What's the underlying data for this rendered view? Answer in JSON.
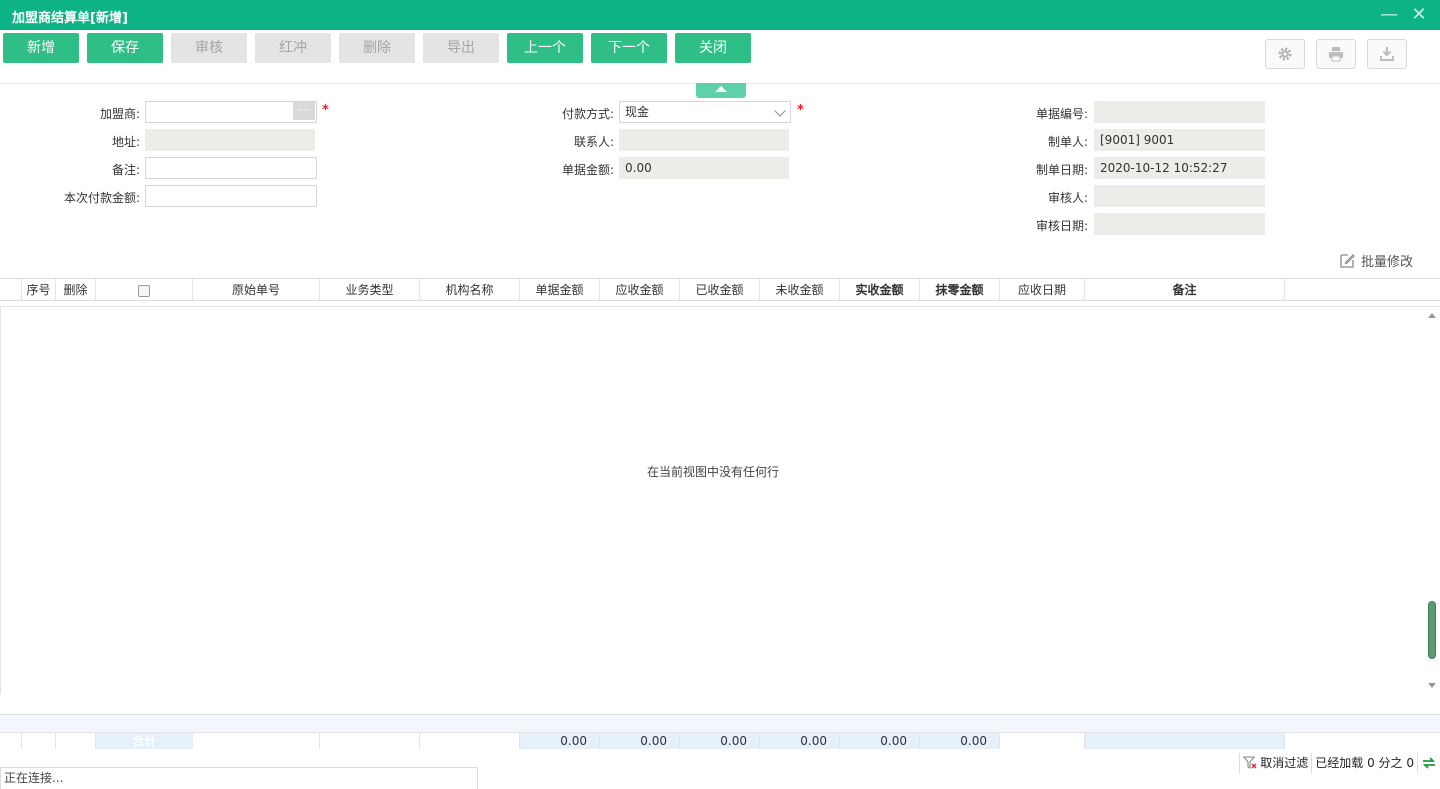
{
  "window": {
    "title": "加盟商结算单[新增]",
    "minimize_glyph": "—",
    "close_glyph": "✕"
  },
  "toolbar": {
    "buttons": [
      {
        "label": "新增",
        "enabled": true
      },
      {
        "label": "保存",
        "enabled": true
      },
      {
        "label": "审核",
        "enabled": false
      },
      {
        "label": "红冲",
        "enabled": false
      },
      {
        "label": "删除",
        "enabled": false
      },
      {
        "label": "导出",
        "enabled": false
      },
      {
        "label": "上一个",
        "enabled": true
      },
      {
        "label": "下一个",
        "enabled": true
      },
      {
        "label": "关闭",
        "enabled": true
      }
    ],
    "icons": [
      "gear-icon",
      "printer-icon",
      "download-icon"
    ]
  },
  "form": {
    "franchisee": {
      "label": "加盟商:",
      "value": ""
    },
    "address": {
      "label": "地址:",
      "value": ""
    },
    "remark": {
      "label": "备注:",
      "value": ""
    },
    "payment_amount": {
      "label": "本次付款金额:",
      "value": ""
    },
    "payment_method": {
      "label": "付款方式:",
      "value": "现金"
    },
    "contact": {
      "label": "联系人:",
      "value": ""
    },
    "document_amount": {
      "label": "单据金额:",
      "value": "0.00"
    },
    "document_no": {
      "label": "单据编号:",
      "value": ""
    },
    "creator": {
      "label": "制单人:",
      "value": "[9001] 9001"
    },
    "create_date": {
      "label": "制单日期:",
      "value": "2020-10-12 10:52:27"
    },
    "auditor": {
      "label": "审核人:",
      "value": ""
    },
    "audit_date": {
      "label": "审核日期:",
      "value": ""
    },
    "required_mark": "*"
  },
  "grid": {
    "batch_edit_label": "批量修改",
    "columns": [
      "",
      "序号",
      "删除",
      "",
      "原始单号",
      "业务类型",
      "机构名称",
      "单据金额",
      "应收金额",
      "已收金额",
      "未收金额",
      "实收金额",
      "抹零金额",
      "应收日期",
      "备注"
    ],
    "empty_message": "在当前视图中没有任何行",
    "totals": {
      "label": "合计",
      "document_amount": "0.00",
      "receivable_amount": "0.00",
      "received_amount": "0.00",
      "unreceived_amount": "0.00",
      "actual_amount": "0.00",
      "rounding_amount": "0.00"
    }
  },
  "status": {
    "connection": "正在连接...",
    "clear_filter": "取消过滤",
    "loaded": "已经加载 0 分之 0"
  },
  "colors": {
    "brand": "#0db384",
    "button": "#2fbf86",
    "disabled_button": "#e4e4e4",
    "readonly_field": "#edece8",
    "required": "#e02020"
  }
}
